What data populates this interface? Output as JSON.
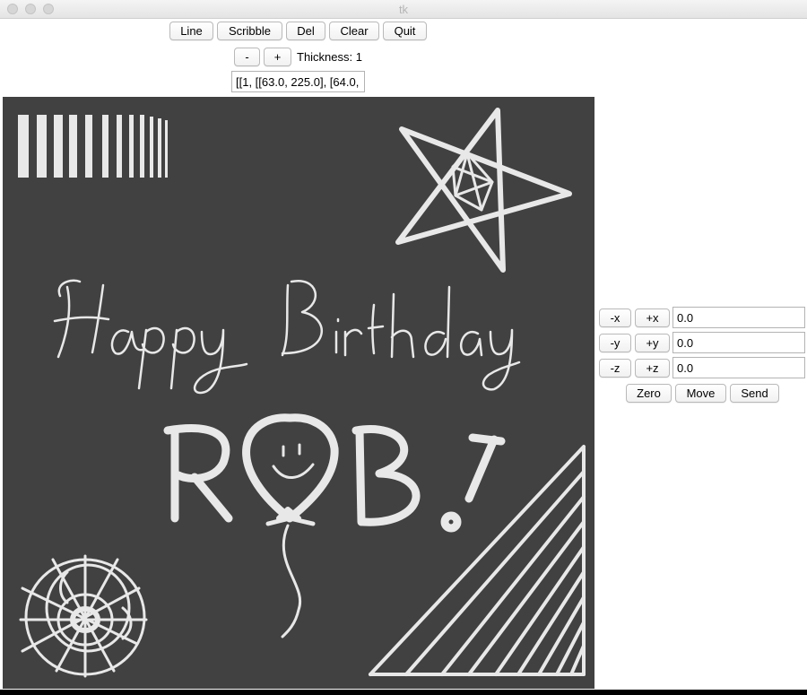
{
  "window": {
    "title": "tk"
  },
  "toolbar": {
    "line": "Line",
    "scribble": "Scribble",
    "del": "Del",
    "clear": "Clear",
    "quit": "Quit"
  },
  "thickness": {
    "minus": "-",
    "plus": "+",
    "label": "Thickness: 1"
  },
  "data_field": {
    "value": "[[1, [[63.0, 225.0], [64.0,"
  },
  "canvas": {
    "background": "#414141",
    "stroke": "#e8e8e8",
    "text_line1": "Happy Birthday",
    "text_line2_a": "R",
    "text_line2_b": "B",
    "text_line2_c": "!"
  },
  "jog": {
    "minus_x": "-x",
    "plus_x": "+x",
    "x_value": "0.0",
    "minus_y": "-y",
    "plus_y": "+y",
    "y_value": "0.0",
    "minus_z": "-z",
    "plus_z": "+z",
    "z_value": "0.0",
    "zero": "Zero",
    "move": "Move",
    "send": "Send"
  }
}
